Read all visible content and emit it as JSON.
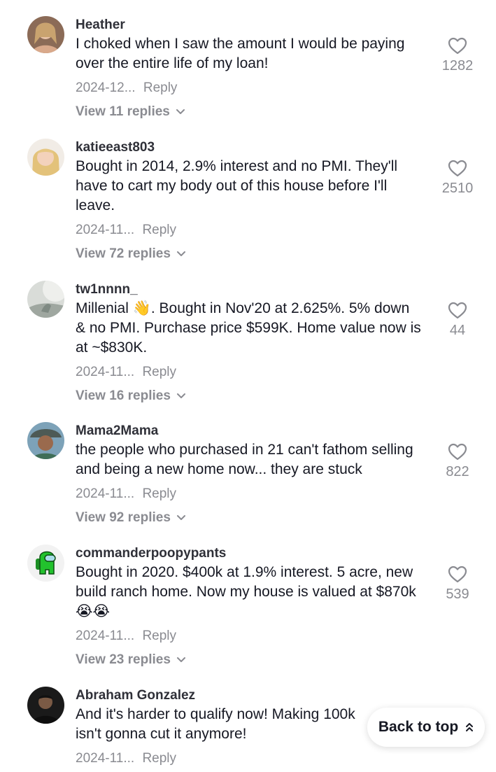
{
  "comments": [
    {
      "username": "Heather",
      "text": "I choked when I saw the amount I would be paying\nover the entire life of my loan!",
      "date": "2024-12...",
      "reply_label": "Reply",
      "view_replies": "View 11 replies",
      "likes": "1282",
      "avatar_icon": "user-avatar"
    },
    {
      "username": "katieeast803",
      "text": "Bought in 2014, 2.9% interest and no PMI. They'll\nhave to cart my body out of this house before I'll\nleave.",
      "date": "2024-11...",
      "reply_label": "Reply",
      "view_replies": "View 72 replies",
      "likes": "2510",
      "avatar_icon": "user-avatar"
    },
    {
      "username": "tw1nnnn_",
      "text": "Millenial 👋. Bought in Nov'20 at 2.625%. 5% down\n& no PMI. Purchase price $599K. Home value now is\nat ~$830K.",
      "date": "2024-11...",
      "reply_label": "Reply",
      "view_replies": "View 16 replies",
      "likes": "44",
      "avatar_icon": "user-avatar"
    },
    {
      "username": "Mama2Mama",
      "text": "the people who purchased in 21 can't fathom selling\nand being a new home now... they are stuck",
      "date": "2024-11...",
      "reply_label": "Reply",
      "view_replies": "View 92 replies",
      "likes": "822",
      "avatar_icon": "user-avatar"
    },
    {
      "username": "commanderpoopypants",
      "text": "Bought in 2020. $400k at 1.9% interest. 5 acre, new\nbuild ranch home. Now my house is valued at $870k\n😭😭",
      "date": "2024-11...",
      "reply_label": "Reply",
      "view_replies": "View 23 replies",
      "likes": "539",
      "avatar_icon": "crewmate-avatar"
    },
    {
      "username": "Abraham Gonzalez",
      "text": "And it's harder to qualify now! Making 100k\nisn't gonna cut it anymore!",
      "date": "2024-11...",
      "reply_label": "Reply",
      "avatar_icon": "user-avatar"
    }
  ],
  "back_to_top": {
    "label": "Back to top",
    "icon": "double-chevron-up-icon"
  },
  "colors": {
    "text": "#161823",
    "muted": "#8a8b91",
    "username": "#2f3038",
    "background": "#ffffff"
  }
}
